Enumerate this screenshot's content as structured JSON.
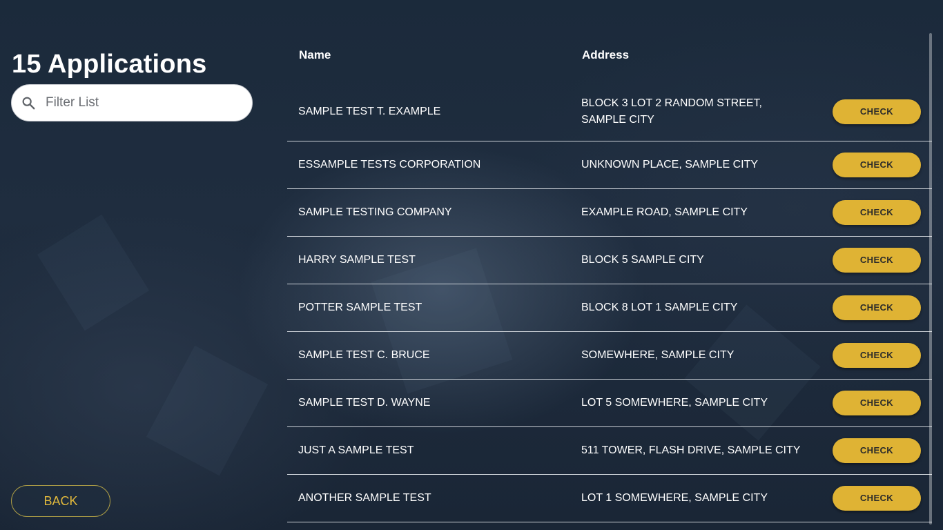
{
  "page": {
    "title": "15 Applications",
    "accent_color": "#dfb334"
  },
  "filter": {
    "placeholder": "Filter List",
    "value": "",
    "icon": "search-icon"
  },
  "back_button": {
    "label": "BACK"
  },
  "table": {
    "columns": [
      "Name",
      "Address",
      ""
    ],
    "rows": [
      {
        "name": "SAMPLE TEST T. EXAMPLE",
        "address": "BLOCK 3 LOT 2 RANDOM STREET, SAMPLE CITY",
        "action": "CHECK"
      },
      {
        "name": "ESSAMPLE TESTS CORPORATION",
        "address": "UNKNOWN PLACE, SAMPLE CITY",
        "action": "CHECK"
      },
      {
        "name": "SAMPLE TESTING COMPANY",
        "address": "EXAMPLE ROAD, SAMPLE CITY",
        "action": "CHECK"
      },
      {
        "name": "HARRY SAMPLE TEST",
        "address": "BLOCK 5 SAMPLE CITY",
        "action": "CHECK"
      },
      {
        "name": "POTTER SAMPLE TEST",
        "address": "BLOCK 8 LOT 1 SAMPLE CITY",
        "action": "CHECK"
      },
      {
        "name": "SAMPLE TEST C. BRUCE",
        "address": "SOMEWHERE, SAMPLE CITY",
        "action": "CHECK"
      },
      {
        "name": "SAMPLE TEST D. WAYNE",
        "address": "LOT 5 SOMEWHERE, SAMPLE CITY",
        "action": "CHECK"
      },
      {
        "name": "JUST A SAMPLE TEST",
        "address": "511 TOWER, FLASH DRIVE, SAMPLE CITY",
        "action": "CHECK"
      },
      {
        "name": "ANOTHER SAMPLE TEST",
        "address": "LOT 1 SOMEWHERE, SAMPLE CITY",
        "action": "CHECK"
      }
    ]
  }
}
